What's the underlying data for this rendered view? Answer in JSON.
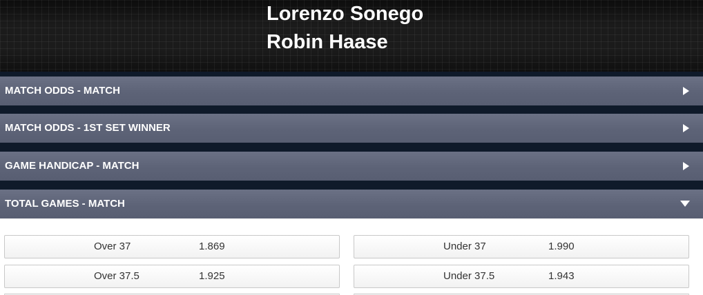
{
  "event": {
    "player1": "Lorenzo Sonego",
    "player2": "Robin Haase"
  },
  "markets": [
    {
      "label": "MATCH ODDS - MATCH",
      "expanded": false,
      "icon": "arrow-right-icon"
    },
    {
      "label": "MATCH ODDS - 1ST SET WINNER",
      "expanded": false,
      "icon": "arrow-right-icon"
    },
    {
      "label": "GAME HANDICAP - MATCH",
      "expanded": false,
      "icon": "arrow-right-icon"
    },
    {
      "label": "TOTAL GAMES - MATCH",
      "expanded": true,
      "icon": "arrow-down-icon"
    }
  ],
  "total_games": {
    "rows": [
      {
        "over": {
          "label": "Over 37",
          "price": "1.869"
        },
        "under": {
          "label": "Under 37",
          "price": "1.990"
        }
      },
      {
        "over": {
          "label": "Over 37.5",
          "price": "1.925"
        },
        "under": {
          "label": "Under 37.5",
          "price": "1.943"
        }
      }
    ]
  },
  "colors": {
    "header_bg": "#1b1b1b",
    "market_bar": "#5d6377",
    "separator": "#0f1a2a",
    "odds_button_bg": "#f5f5f5",
    "text_white": "#ffffff",
    "text_dark": "#333333"
  }
}
